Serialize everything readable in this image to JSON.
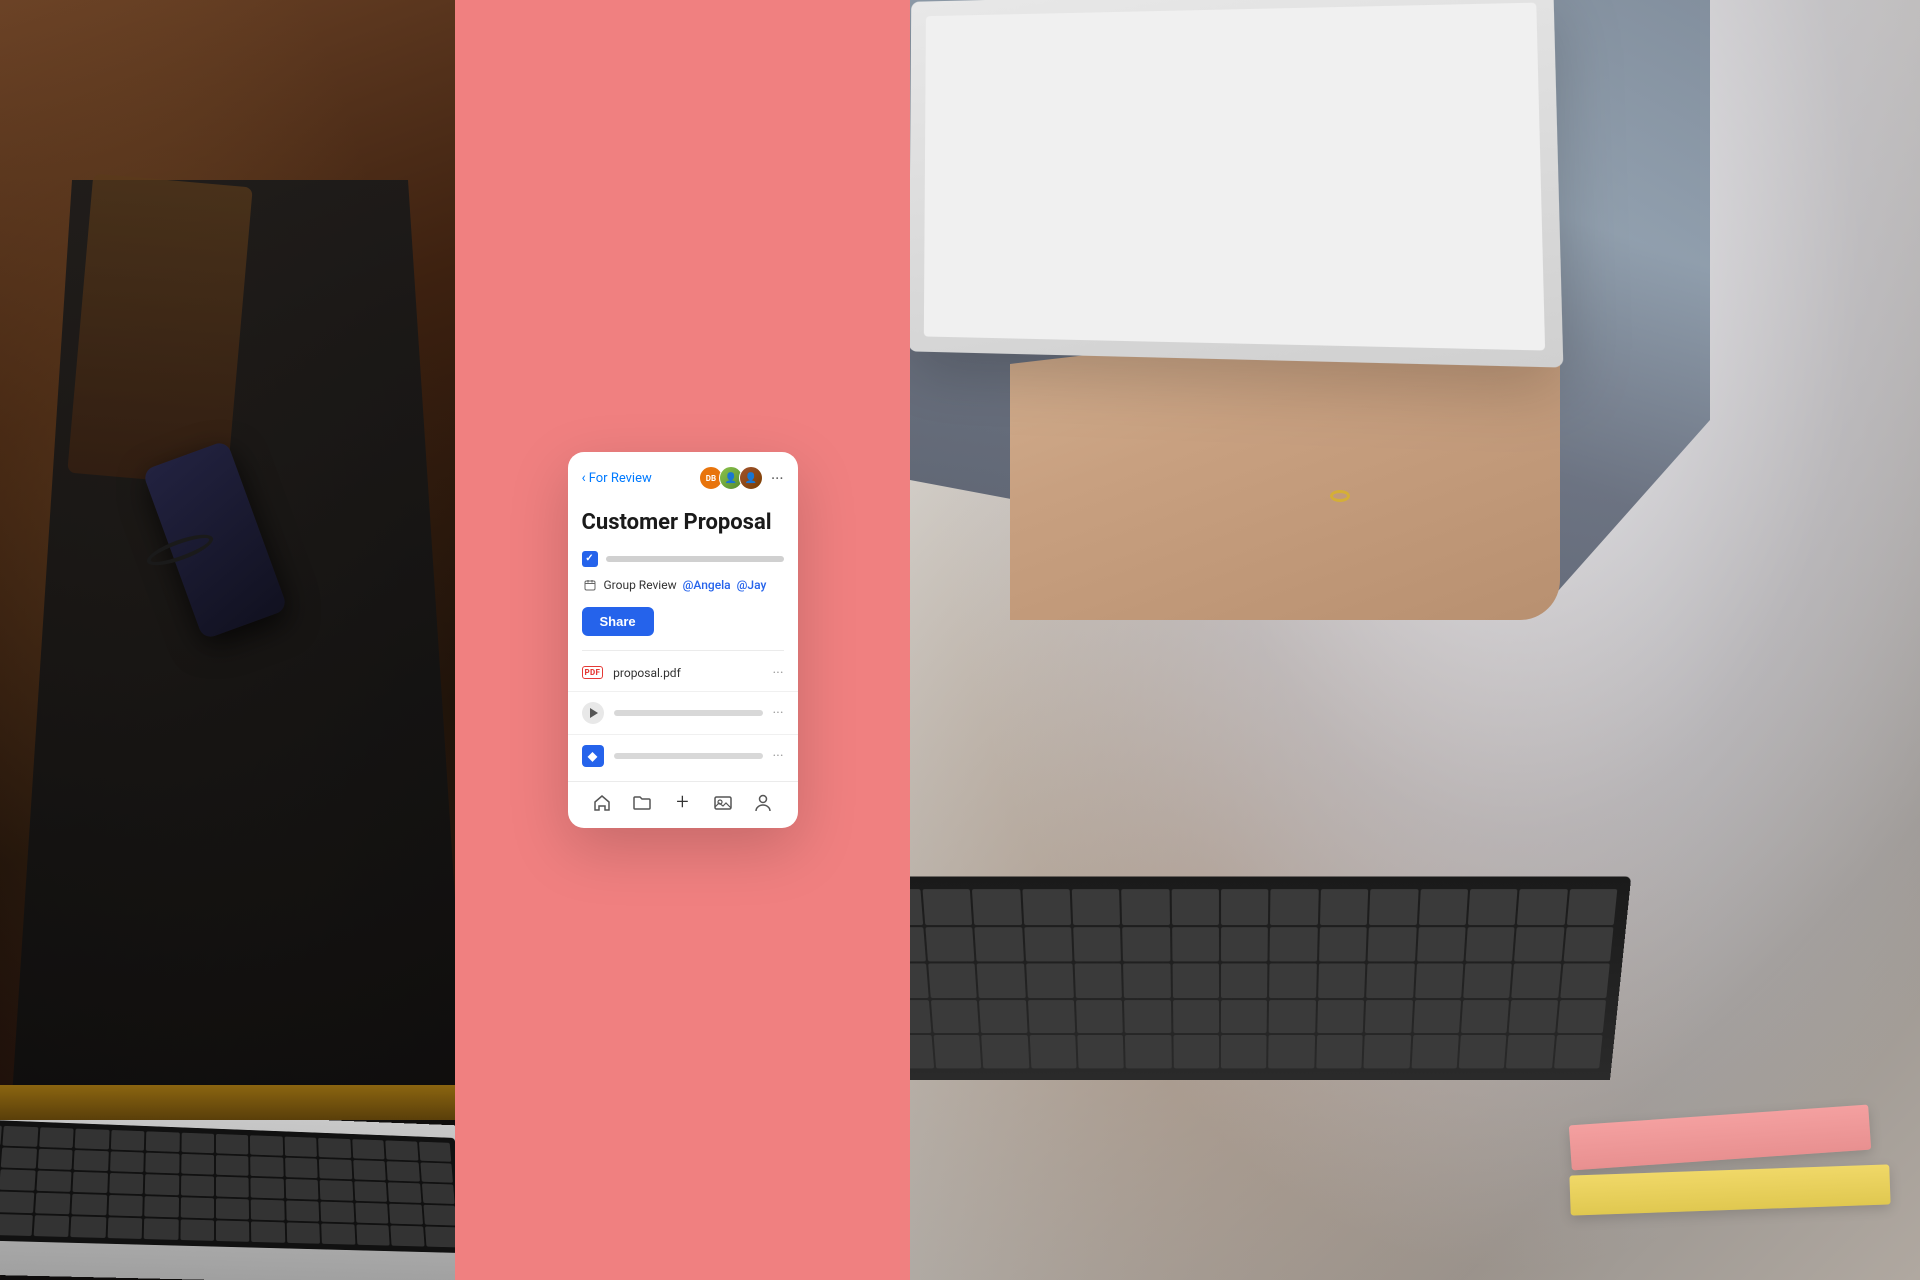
{
  "panels": {
    "left": {
      "alt": "Person using phone and laptop"
    },
    "center": {
      "bg_color": "#f08080"
    },
    "right": {
      "alt": "Person using laptop"
    }
  },
  "app_card": {
    "header": {
      "back_label": "For Review",
      "avatars": [
        {
          "id": "db",
          "initials": "DB",
          "color": "#E8740C"
        },
        {
          "id": "angela",
          "initials": "",
          "color": "#8BC34A"
        },
        {
          "id": "jay",
          "initials": "",
          "color": "#A0522D"
        }
      ],
      "more_label": "···"
    },
    "title": "Customer Proposal",
    "task_row": {
      "checked": true,
      "bar_placeholder": ""
    },
    "group_review": {
      "label": "Group Review",
      "mention1": "@Angela",
      "mention2": "@Jay"
    },
    "share_button": "Share",
    "files": [
      {
        "type": "pdf",
        "type_label": "PDF",
        "name": "proposal.pdf",
        "more": "···"
      },
      {
        "type": "video",
        "name_placeholder": "",
        "more": "···"
      },
      {
        "type": "dropbox",
        "name_placeholder": "",
        "more": "···"
      }
    ],
    "bottom_nav": [
      {
        "id": "home",
        "icon": "⌂",
        "label": "Home"
      },
      {
        "id": "folder",
        "icon": "🗂",
        "label": "Folder"
      },
      {
        "id": "add",
        "icon": "+",
        "label": "Add"
      },
      {
        "id": "photo",
        "icon": "⊟",
        "label": "Photo"
      },
      {
        "id": "person",
        "icon": "⊙",
        "label": "Person"
      }
    ]
  }
}
